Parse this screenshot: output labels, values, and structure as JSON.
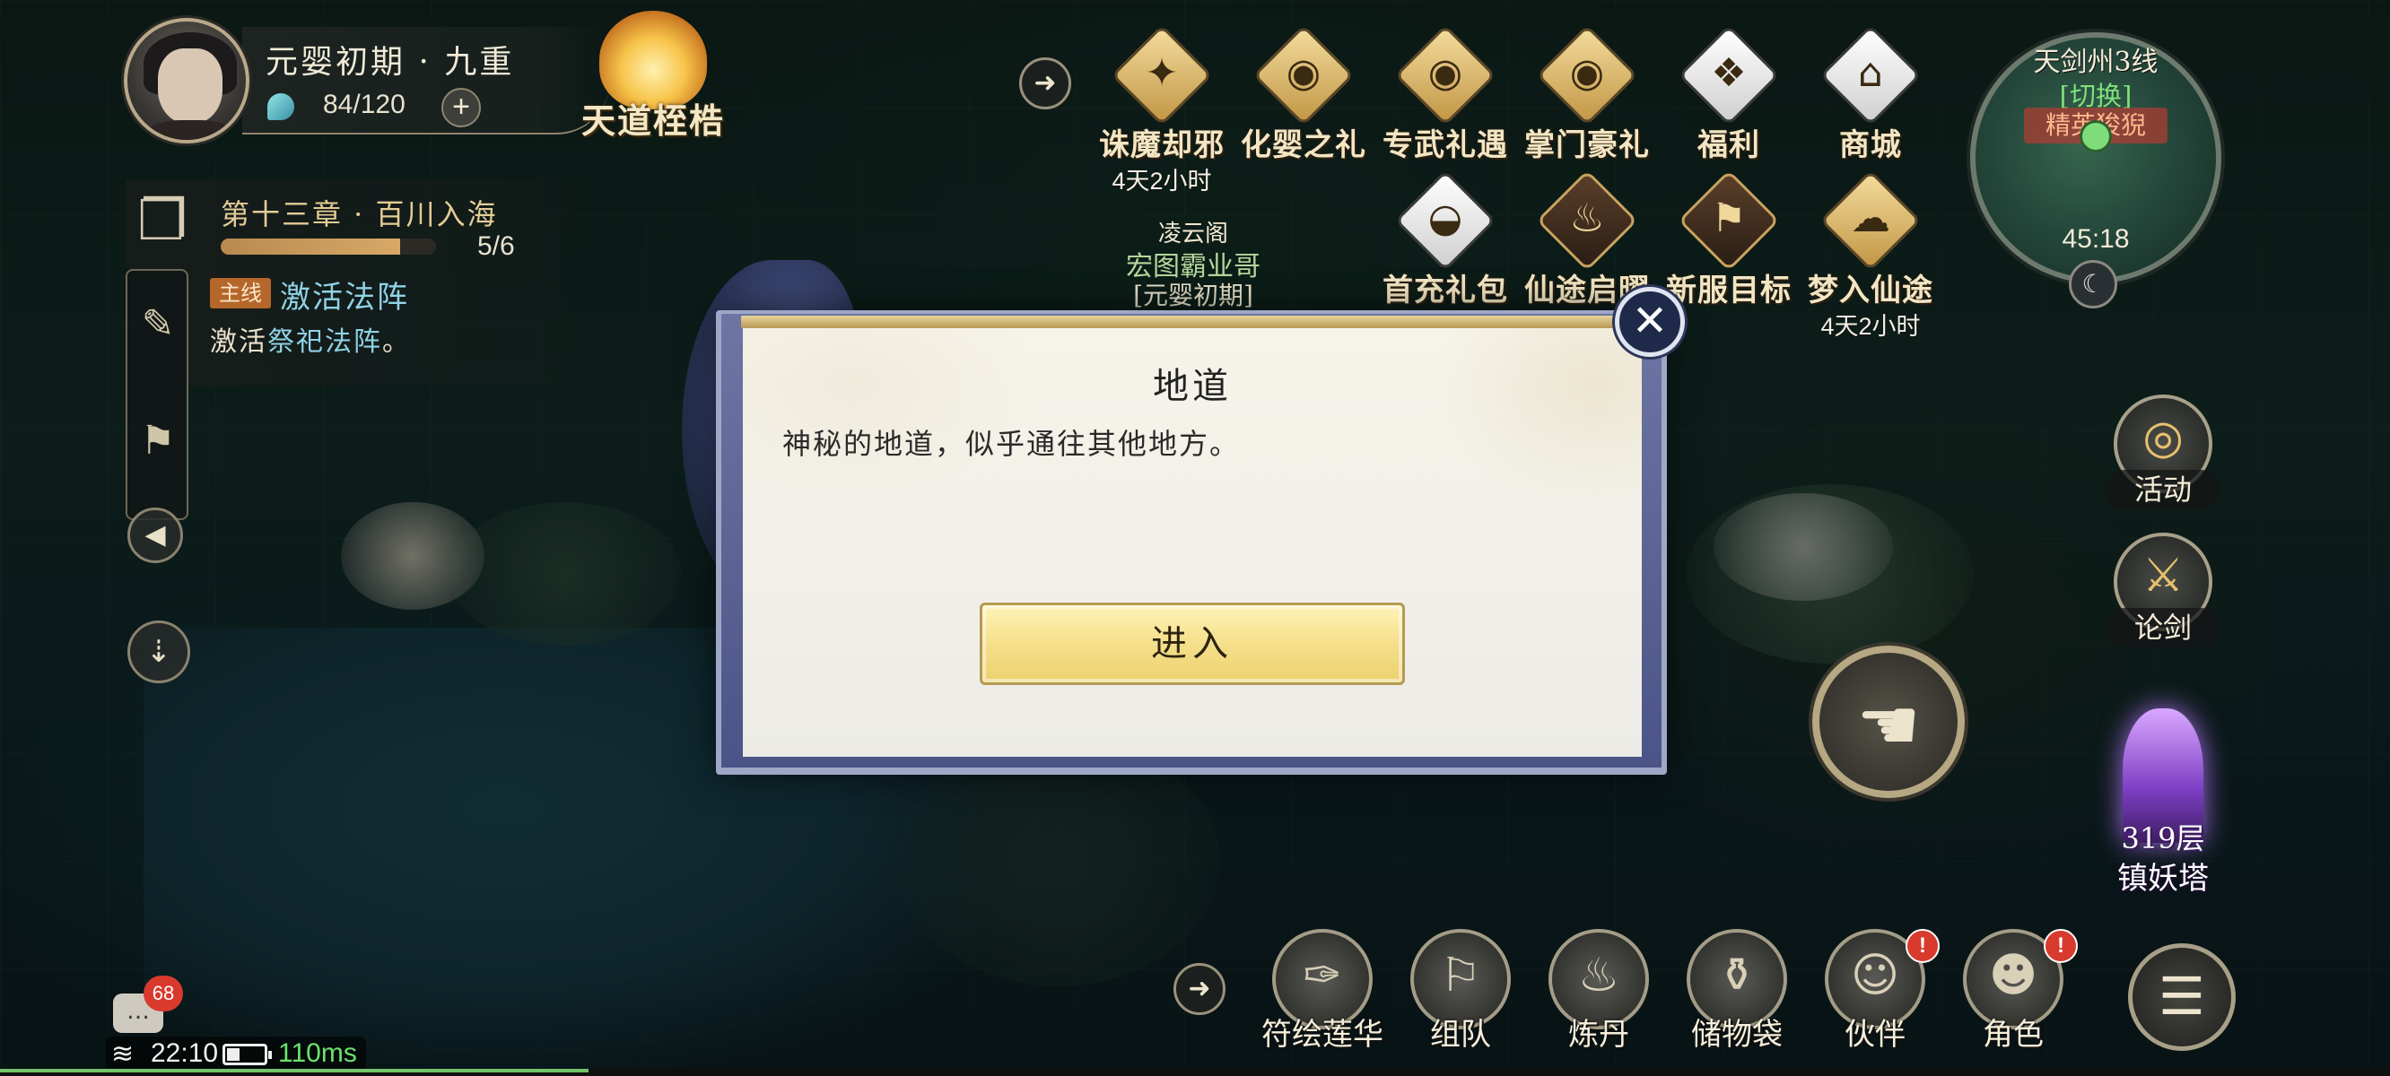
{
  "player": {
    "name": "元婴初期 · 九重",
    "energy": "84/120",
    "energy_add_label": "+"
  },
  "tiandao": {
    "label": "天道桎梏"
  },
  "chapter": {
    "title": "第十三章 · 百川入海",
    "progress_text": "5/6",
    "progress_fraction": 0.833
  },
  "quest": {
    "tag": "主线",
    "title": "激活法阵",
    "desc_prefix": "激活",
    "desc_highlight": "祭祀法阵",
    "desc_suffix": "。"
  },
  "top_events": [
    {
      "label": "诛魔却邪",
      "sub": "4天2小时",
      "icon": "demon-slay-icon"
    },
    {
      "label": "化婴之礼",
      "sub": "",
      "icon": "gift-chest-icon"
    },
    {
      "label": "专武礼遇",
      "sub": "",
      "icon": "gift-chest-icon"
    },
    {
      "label": "掌门豪礼",
      "sub": "",
      "icon": "gift-chest-icon"
    },
    {
      "label": "福利",
      "sub": "",
      "icon": "fortune-bag-icon"
    },
    {
      "label": "商城",
      "sub": "",
      "icon": "pavilion-icon"
    }
  ],
  "second_events": [
    {
      "label": "首充礼包",
      "sub": "",
      "icon": "ingot-icon"
    },
    {
      "label": "仙途启曜",
      "sub": "",
      "icon": "lantern-icon"
    },
    {
      "label": "新服目标",
      "sub": "",
      "icon": "flag-icon"
    },
    {
      "label": "梦入仙途",
      "sub": "4天2小时",
      "icon": "cloud-icon"
    }
  ],
  "npc": {
    "sect": "凌云阁",
    "name": "宏图霸业哥",
    "rank": "[元婴初期]"
  },
  "minimap": {
    "server": "天剑州3线",
    "switch_label": "[切换]",
    "tag": "精英狻猊",
    "time": "45:18"
  },
  "right_buttons": [
    {
      "label": "活动"
    },
    {
      "label": "论剑"
    }
  ],
  "tower": {
    "floor": "319层",
    "label": "镇妖塔"
  },
  "bottom_buttons": [
    {
      "label": "符绘莲华",
      "badge": ""
    },
    {
      "label": "组队",
      "badge": ""
    },
    {
      "label": "炼丹",
      "badge": ""
    },
    {
      "label": "储物袋",
      "badge": ""
    },
    {
      "label": "伙伴",
      "badge": "!"
    },
    {
      "label": "角色",
      "badge": "!"
    }
  ],
  "chat": {
    "unread": "68"
  },
  "status": {
    "time": "22:10",
    "ping": "110ms",
    "battery_fraction": 0.35
  },
  "dialog": {
    "title": "地道",
    "description": "神秘的地道，似乎通往其他地方。",
    "enter_label": "进入"
  },
  "colors": {
    "accent_gold": "#f5df8a",
    "quest_blue": "#8fd3e6",
    "ping_green": "#6be36b",
    "badge_red": "#d83a2e"
  }
}
